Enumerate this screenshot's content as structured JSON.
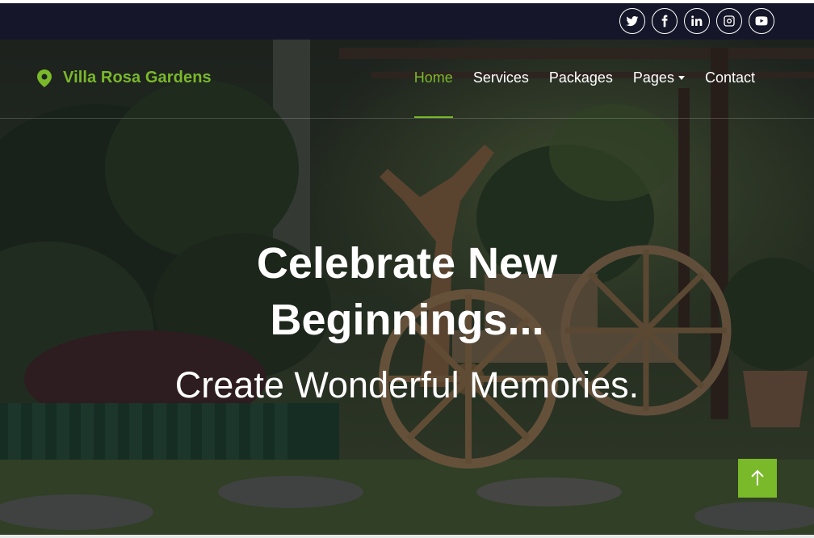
{
  "topbar": {
    "socials": [
      {
        "icon": "twitter-icon"
      },
      {
        "icon": "facebook-icon"
      },
      {
        "icon": "linkedin-icon"
      },
      {
        "icon": "instagram-icon"
      },
      {
        "icon": "youtube-icon"
      }
    ]
  },
  "brand": {
    "name": "Villa Rosa Gardens",
    "icon": "map-marker-icon"
  },
  "nav": {
    "items": [
      {
        "label": "Home",
        "active": true
      },
      {
        "label": "Services"
      },
      {
        "label": "Packages"
      },
      {
        "label": "Pages",
        "dropdown": true
      },
      {
        "label": "Contact"
      }
    ]
  },
  "hero": {
    "title": "Celebrate New Beginnings...",
    "subtitle": "Create Wonderful Memories."
  },
  "colors": {
    "accent": "#7ab929",
    "topbar": "#16162a",
    "text": "#ffffff"
  }
}
